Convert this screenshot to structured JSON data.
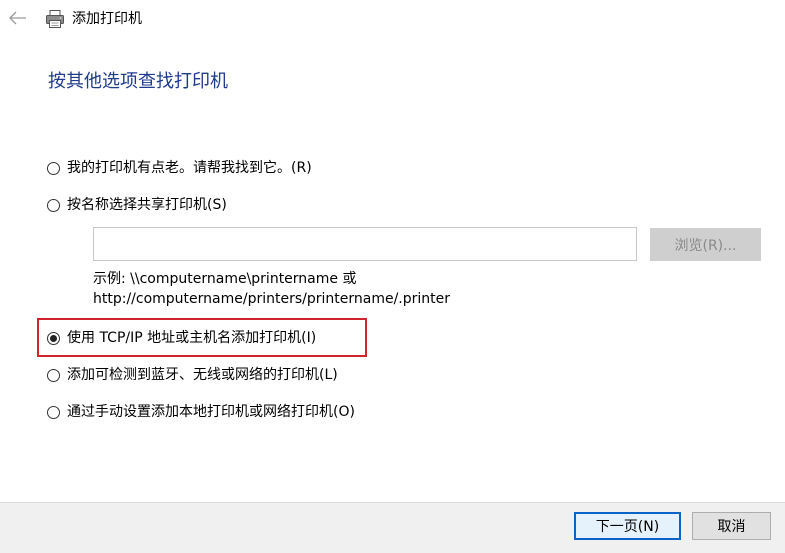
{
  "window": {
    "title": "添加打印机",
    "back_icon": "arrow-left-icon",
    "app_icon": "printer-icon"
  },
  "heading": "按其他选项查找打印机",
  "options": [
    {
      "label": "我的打印机有点老。请帮我找到它。(R)",
      "checked": false
    },
    {
      "label": "按名称选择共享打印机(S)",
      "checked": false
    },
    {
      "label": "使用 TCP/IP 地址或主机名添加打印机(I)",
      "checked": true
    },
    {
      "label": "添加可检测到蓝牙、无线或网络的打印机(L)",
      "checked": false
    },
    {
      "label": "通过手动设置添加本地打印机或网络打印机(O)",
      "checked": false
    }
  ],
  "shared": {
    "input_value": "",
    "browse_label": "浏览(R)...",
    "example_line1": "示例: \\\\computername\\printername 或",
    "example_line2": "http://computername/printers/printername/.printer"
  },
  "footer": {
    "next_label": "下一页(N)",
    "cancel_label": "取消"
  },
  "colors": {
    "heading": "#1e3b8c",
    "highlight": "#d0252b",
    "primary_border": "#0a64c8"
  }
}
